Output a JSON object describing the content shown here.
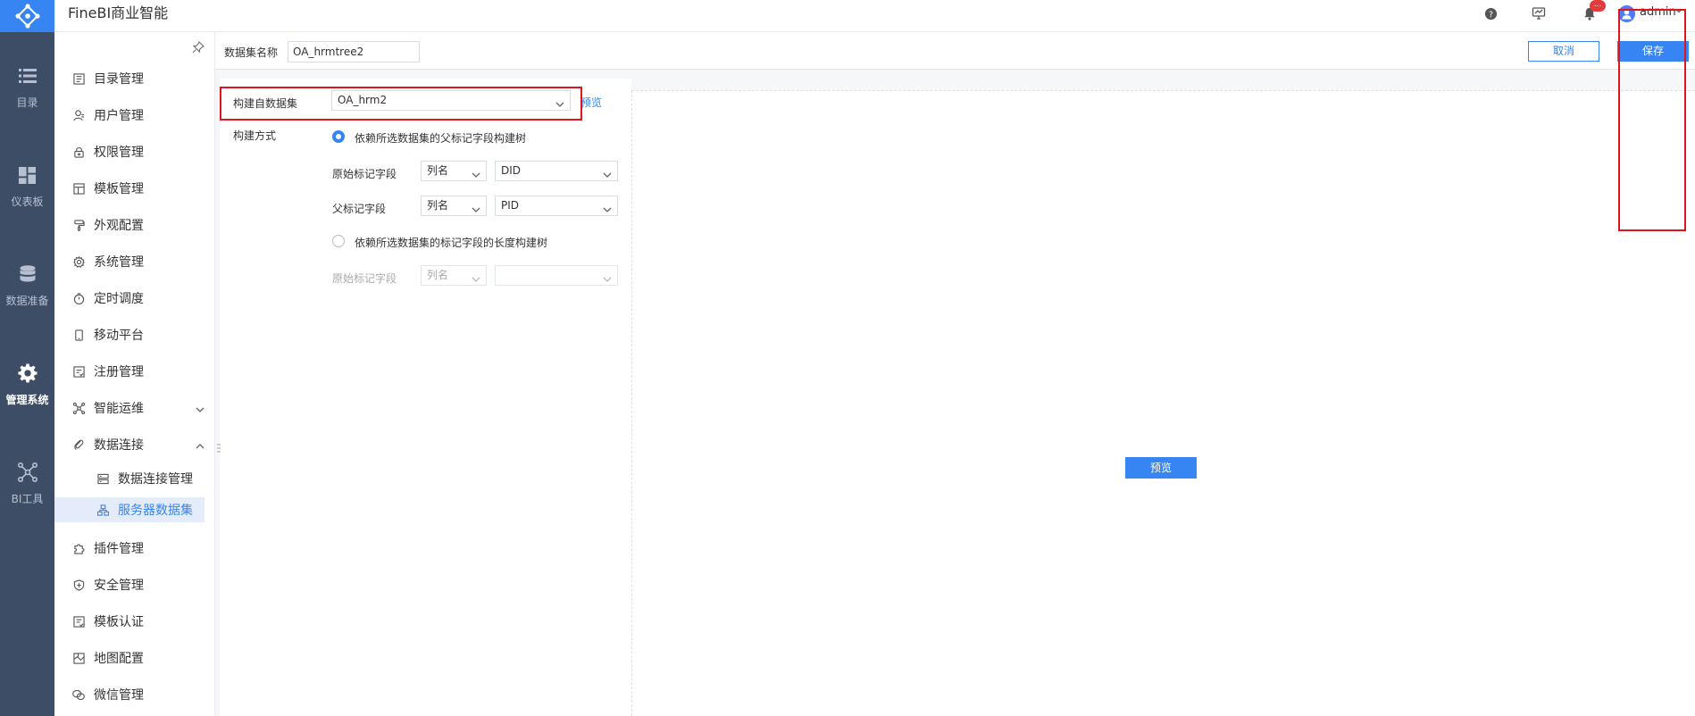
{
  "header": {
    "app_title": "FineBI商业智能",
    "notification_badge": "...",
    "user_name": "admin",
    "colors": {
      "brand": "#3685f2",
      "rail": "#3d4d66",
      "badge": "#e23b3b"
    }
  },
  "rail": {
    "items": [
      {
        "label": "目录",
        "icon": "list-icon"
      },
      {
        "label": "仪表板",
        "icon": "dashboard-icon"
      },
      {
        "label": "数据准备",
        "icon": "database-icon"
      },
      {
        "label": "管理系统",
        "icon": "gear-icon",
        "active": true
      },
      {
        "label": "BI工具",
        "icon": "network-icon"
      }
    ]
  },
  "menu": {
    "items": [
      {
        "label": "目录管理",
        "icon": "catalog-icon"
      },
      {
        "label": "用户管理",
        "icon": "user-icon"
      },
      {
        "label": "权限管理",
        "icon": "lock-icon"
      },
      {
        "label": "模板管理",
        "icon": "template-icon"
      },
      {
        "label": "外观配置",
        "icon": "brush-icon"
      },
      {
        "label": "系统管理",
        "icon": "settings-icon"
      },
      {
        "label": "定时调度",
        "icon": "timer-icon"
      },
      {
        "label": "移动平台",
        "icon": "mobile-icon"
      },
      {
        "label": "注册管理",
        "icon": "register-icon"
      },
      {
        "label": "智能运维",
        "icon": "ops-icon",
        "expandable": true
      },
      {
        "label": "数据连接",
        "icon": "link-icon",
        "expanded": true
      },
      {
        "label": "数据连接管理",
        "icon": "server-icon",
        "sub": true
      },
      {
        "label": "服务器数据集",
        "icon": "dataset-icon",
        "sub": true,
        "active": true
      },
      {
        "label": "插件管理",
        "icon": "plugin-icon"
      },
      {
        "label": "安全管理",
        "icon": "shield-icon"
      },
      {
        "label": "模板认证",
        "icon": "certify-icon"
      },
      {
        "label": "地图配置",
        "icon": "map-icon"
      },
      {
        "label": "微信管理",
        "icon": "wechat-icon"
      }
    ]
  },
  "form": {
    "dataset_name_label": "数据集名称",
    "dataset_name_value": "OA_hrmtree2",
    "cancel_label": "取消",
    "save_label": "保存"
  },
  "build": {
    "source_label": "构建自数据集",
    "source_value": "OA_hrm2",
    "preview_link": "预览",
    "method_label": "构建方式",
    "option1": "依赖所选数据集的父标记字段构建树",
    "option2": "依赖所选数据集的标记字段的长度构建树",
    "orig_field_label": "原始标记字段",
    "parent_field_label": "父标记字段",
    "orig_field_label2": "原始标记字段",
    "col_type_1": "列名",
    "col_type_2": "列名",
    "col_type_3": "列名",
    "orig_field_value": "DID",
    "parent_field_value": "PID",
    "orig_field_value2": ""
  },
  "preview": {
    "button_label": "预览"
  }
}
